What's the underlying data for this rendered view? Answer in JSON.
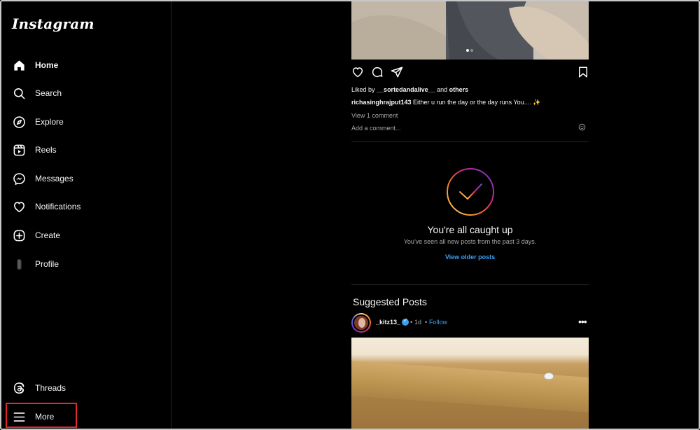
{
  "app": {
    "logo": "Instagram"
  },
  "sidebar": {
    "items": [
      {
        "label": "Home",
        "icon": "home-icon",
        "active": true
      },
      {
        "label": "Search",
        "icon": "search-icon"
      },
      {
        "label": "Explore",
        "icon": "compass-icon"
      },
      {
        "label": "Reels",
        "icon": "reels-icon"
      },
      {
        "label": "Messages",
        "icon": "messenger-icon"
      },
      {
        "label": "Notifications",
        "icon": "heart-icon"
      },
      {
        "label": "Create",
        "icon": "plus-square-icon"
      },
      {
        "label": "Profile",
        "icon": "profile-avatar-icon"
      }
    ],
    "bottom": [
      {
        "label": "Threads",
        "icon": "threads-icon"
      },
      {
        "label": "More",
        "icon": "hamburger-menu-icon"
      }
    ]
  },
  "post": {
    "liked_prefix": "Liked by",
    "liked_user": "__sortedandalive__",
    "liked_and": "and",
    "liked_others": "others",
    "caption_user": "richasinghrajput143",
    "caption_text": "Either u run the day or the day runs You.... ✨",
    "view_comments": "View 1 comment",
    "add_comment_placeholder": "Add a comment..."
  },
  "caught_up": {
    "title": "You're all caught up",
    "subtitle": "You've seen all new posts from the past 3 days.",
    "link": "View older posts"
  },
  "suggested": {
    "heading": "Suggested Posts",
    "username": "_kitz13_",
    "separator": "•",
    "time": "1d",
    "follow_separator": "•",
    "follow": "Follow",
    "more": "•••"
  },
  "colors": {
    "accent": "#3aa0f3",
    "highlight_box": "#e3262f",
    "background": "#000000"
  }
}
